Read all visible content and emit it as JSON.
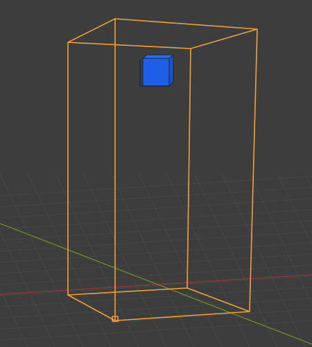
{
  "viewport": {
    "background_color": "#3d3d3d",
    "grid_color": "#474747",
    "x_axis_color": "#8a3a3a",
    "y_axis_color": "#6b8a2a"
  },
  "selection": {
    "outline_color": "#f0a040",
    "object": "tall-box-selected"
  },
  "cube": {
    "fill_color": "#1f5fe8",
    "edge_color": "#1a2540"
  }
}
